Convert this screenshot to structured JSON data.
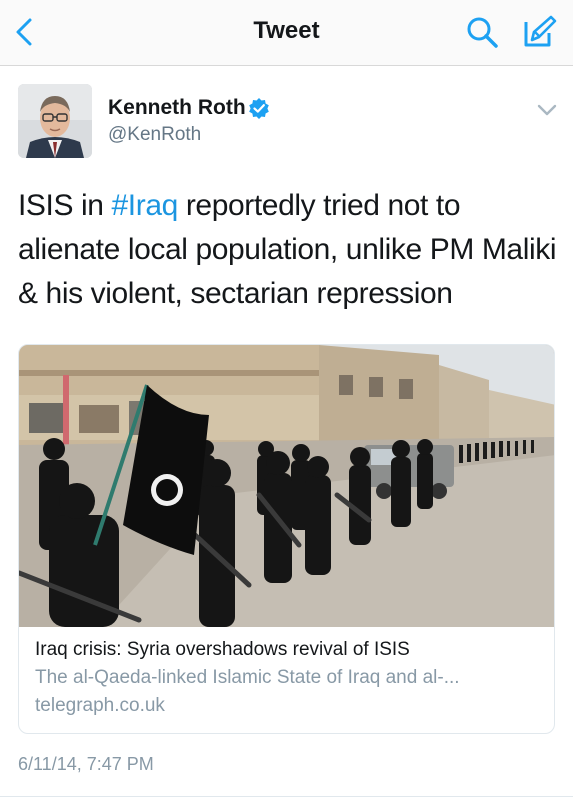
{
  "nav": {
    "title": "Tweet",
    "back_icon": "chevron-left-icon",
    "search_icon": "search-icon",
    "compose_icon": "compose-icon",
    "accent_color": "#1da1f2"
  },
  "tweet": {
    "author_name": "Kenneth Roth",
    "author_handle": "@KenRoth",
    "verified": true,
    "text_before": "ISIS in ",
    "hashtag": "#Iraq",
    "text_after": " reportedly tried not to alienate local population, unlike PM Maliki & his violent, sectarian repression",
    "timestamp": "6/11/14, 7:47 PM"
  },
  "card": {
    "title": "Iraq crisis: Syria overshadows revival of ISIS",
    "description": "The al-Qaeda-linked Islamic State of Iraq and al-...",
    "domain": "telegraph.co.uk"
  }
}
